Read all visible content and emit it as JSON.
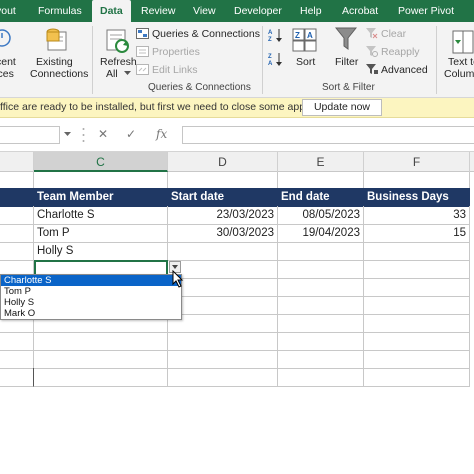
{
  "menu_tabs": [
    {
      "label": "yout"
    },
    {
      "label": "Formulas"
    },
    {
      "label": "Data",
      "active": true
    },
    {
      "label": "Review"
    },
    {
      "label": "View"
    },
    {
      "label": "Developer"
    },
    {
      "label": "Help"
    },
    {
      "label": "Acrobat"
    },
    {
      "label": "Power Pivot"
    }
  ],
  "ribbon": {
    "recent_sources": [
      "cent",
      "rces"
    ],
    "existing_connections": [
      "Existing",
      "Connections"
    ],
    "refresh_all": [
      "Refresh",
      "All"
    ],
    "queries_connections": "Queries & Connections",
    "properties": "Properties",
    "edit_links": "Edit Links",
    "group_queries": "Queries & Connections",
    "sort": "Sort",
    "filter": "Filter",
    "clear": "Clear",
    "reapply": "Reapply",
    "advanced": "Advanced",
    "group_sort_filter": "Sort & Filter",
    "text_to_columns": [
      "Text to",
      "Colum"
    ]
  },
  "message_bar": {
    "text": "ffice are ready to be installed, but first we need to close some apps.",
    "button": "Update now"
  },
  "formula_bar": {
    "cancel": "✕",
    "enter": "✓",
    "fx": "fx",
    "value": ""
  },
  "columns": [
    "C",
    "D",
    "E",
    "F"
  ],
  "table": {
    "headers": [
      "Team Member",
      "Start date",
      "End date",
      "Business Days"
    ],
    "rows": [
      [
        "Charlotte S",
        "23/03/2023",
        "08/05/2023",
        "33"
      ],
      [
        "Tom P",
        "30/03/2023",
        "19/04/2023",
        "15"
      ],
      [
        "Holly S",
        "",
        "",
        ""
      ]
    ]
  },
  "dropdown": {
    "options": [
      "Charlotte S",
      "Tom P",
      "Holly S",
      "Mark O"
    ],
    "selected_index": 0
  },
  "colors": {
    "excel_green": "#217346",
    "table_header": "#1f3864",
    "dropdown_selected": "#0a64c8",
    "message_bar": "#fcf5c0"
  }
}
